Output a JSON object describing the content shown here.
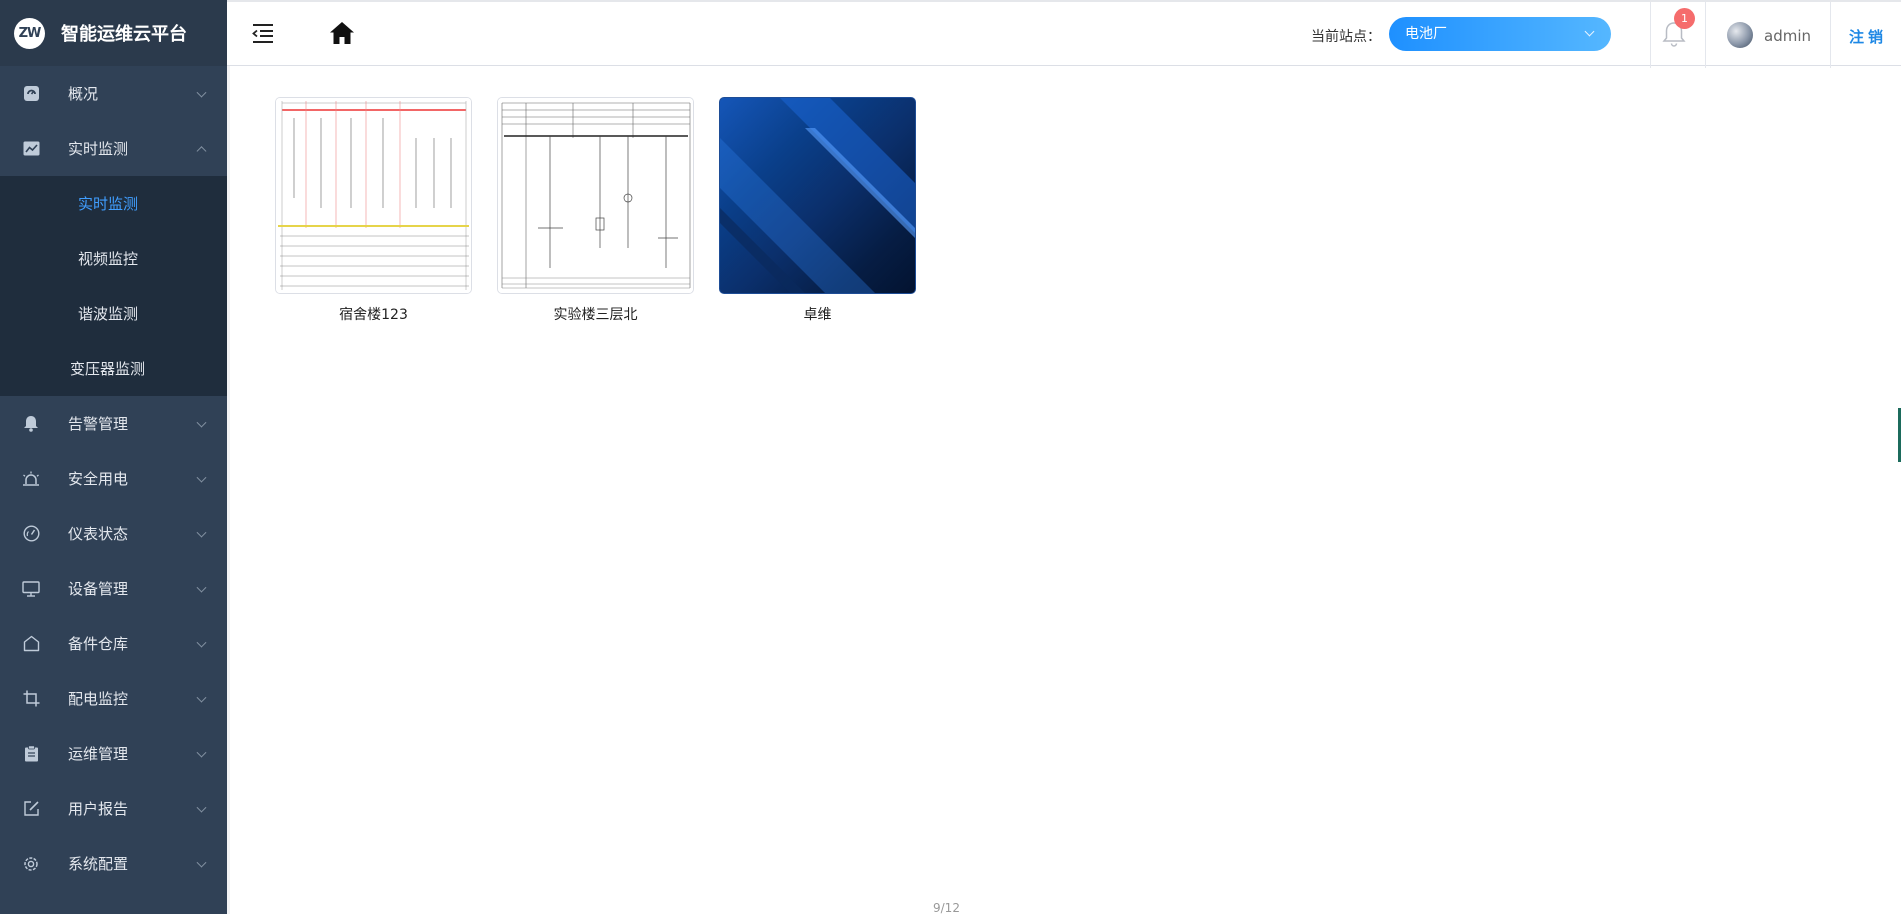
{
  "app": {
    "logo_text": "ZW",
    "title": "智能运维云平台"
  },
  "sidebar": {
    "items": [
      {
        "label": "概况",
        "icon": "dashboard-icon",
        "expanded": false
      },
      {
        "label": "实时监测",
        "icon": "chart-icon",
        "expanded": true,
        "children": [
          {
            "label": "实时监测",
            "active": true
          },
          {
            "label": "视频监控",
            "active": false
          },
          {
            "label": "谐波监测",
            "active": false
          },
          {
            "label": "变压器监测",
            "active": false
          }
        ]
      },
      {
        "label": "告警管理",
        "icon": "bell-icon",
        "expanded": false
      },
      {
        "label": "安全用电",
        "icon": "alarm-lamp-icon",
        "expanded": false
      },
      {
        "label": "仪表状态",
        "icon": "gauge-icon",
        "expanded": false
      },
      {
        "label": "设备管理",
        "icon": "monitor-icon",
        "expanded": false
      },
      {
        "label": "备件仓库",
        "icon": "warehouse-icon",
        "expanded": false
      },
      {
        "label": "配电监控",
        "icon": "crop-icon",
        "expanded": false
      },
      {
        "label": "运维管理",
        "icon": "clipboard-icon",
        "expanded": false
      },
      {
        "label": "用户报告",
        "icon": "edit-icon",
        "expanded": false
      },
      {
        "label": "系统配置",
        "icon": "gear-icon",
        "expanded": false
      }
    ]
  },
  "header": {
    "site_label": "当前站点：",
    "site_value": "电池厂",
    "notification_count": "1",
    "username": "admin",
    "logout_label": "注销"
  },
  "cards": [
    {
      "label": "宿舍楼123",
      "thumb": "single-line-diagram-thumbnail"
    },
    {
      "label": "实验楼三层北",
      "thumb": "single-line-diagram-thumbnail"
    },
    {
      "label": "卓维",
      "thumb": "blue-abstract-thumbnail"
    }
  ],
  "footer": {
    "pager": "9/12"
  },
  "colors": {
    "sidebar_bg": "#304156",
    "submenu_bg": "#1f2d3d",
    "accent": "#409eff",
    "badge": "#f56c6c"
  }
}
